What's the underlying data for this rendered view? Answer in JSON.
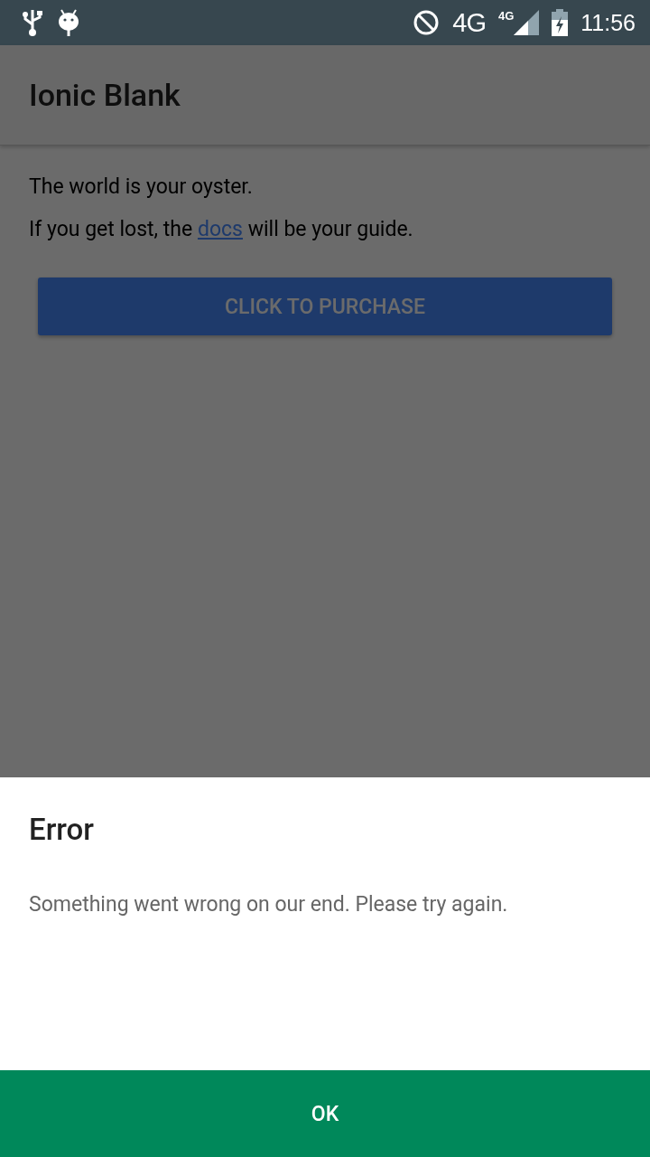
{
  "status_bar": {
    "network": "4G",
    "network_small": "4G",
    "time": "11:56"
  },
  "header": {
    "title": "Ionic Blank"
  },
  "content": {
    "paragraphs": [
      {
        "text": "The world is your oyster."
      },
      {
        "before": "If you get lost, the ",
        "link": "docs",
        "after": " will be your guide."
      }
    ],
    "button": "CLICK TO PURCHASE"
  },
  "dialog": {
    "title": "Error",
    "message": "Something went wrong on our end. Please try again.",
    "buttons": [
      "OK"
    ]
  }
}
